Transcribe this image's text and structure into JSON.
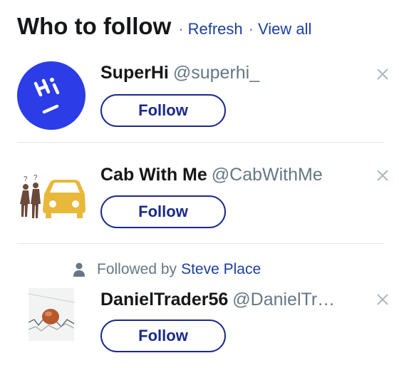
{
  "header": {
    "title": "Who to follow",
    "separator": "·",
    "refresh_label": "Refresh",
    "view_all_label": "View all"
  },
  "suggestions": [
    {
      "name": "SuperHi",
      "handle": "@superhi_",
      "follow_label": "Follow",
      "avatar": "superhi-logo-avatar",
      "avatar_color": "#2b3de6"
    },
    {
      "name": "Cab With Me",
      "handle": "@CabWithMe",
      "follow_label": "Follow",
      "avatar": "cab-with-me-logo-avatar",
      "avatar_color": "#e8b83a"
    },
    {
      "social_context_prefix": "Followed by",
      "social_context_name": "Steve Place",
      "name": "DanielTrader56",
      "handle": "@DanielTr…",
      "follow_label": "Follow",
      "avatar": "coin-on-chart-avatar"
    }
  ],
  "icons": {
    "dismiss": "close-icon",
    "social": "person-icon"
  },
  "colors": {
    "link": "#1b3fa1",
    "button_border": "#1b2a8a",
    "muted": "#657786",
    "divider": "#e1e8ed"
  }
}
